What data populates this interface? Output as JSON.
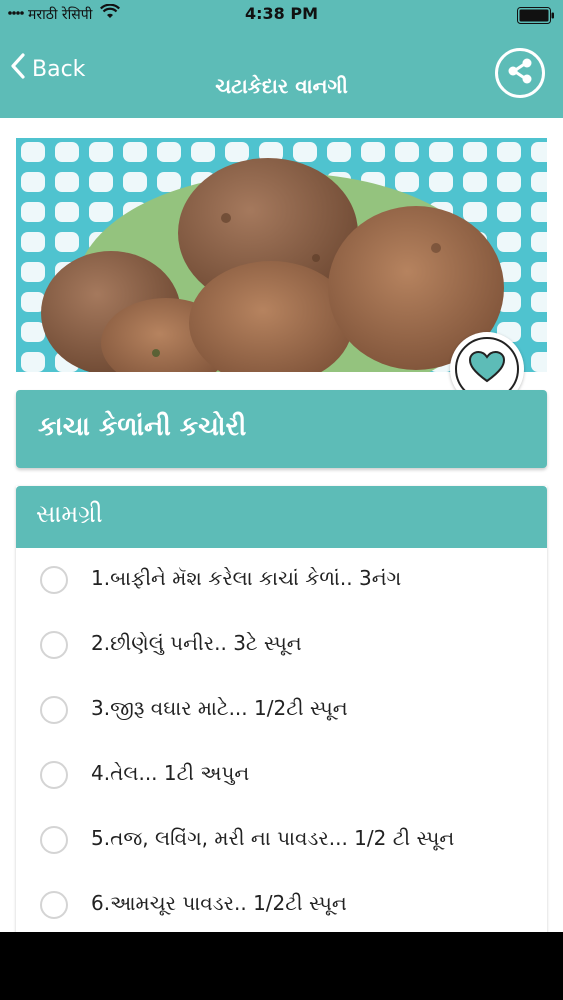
{
  "status_bar": {
    "carrier": "मराठी रेसिपी",
    "time": "4:38 PM",
    "battery_level": 1.0
  },
  "nav": {
    "back_label": "Back",
    "title": "ચટાકેદાર વાનગી",
    "share_icon": "share-icon"
  },
  "colors": {
    "primary": "#5dbcb7",
    "heart": "#5dbcb7"
  },
  "recipe": {
    "title": "કાચા કેળાંની કચોરી",
    "favorite_icon": "heart-icon"
  },
  "ingredients": {
    "heading": "સામગ્રી",
    "items": [
      "1.બાફીને મૅશ કરેલા કાચાં કેળાં.. 3નંગ",
      "2.છીણેલું પનીર.. 3ટે સ્પૂન",
      "3.જીરૂ વઘાર માટે... 1/2ટી સ્પૂન",
      "4.તેલ... 1ટી અપુન",
      "5.તજ, લવિંગ, મરી ના પાવડર... 1/2 ટી સ્પૂન",
      "6.આમચૂર પાવડર.. 1/2ટી સ્પૂન"
    ]
  }
}
